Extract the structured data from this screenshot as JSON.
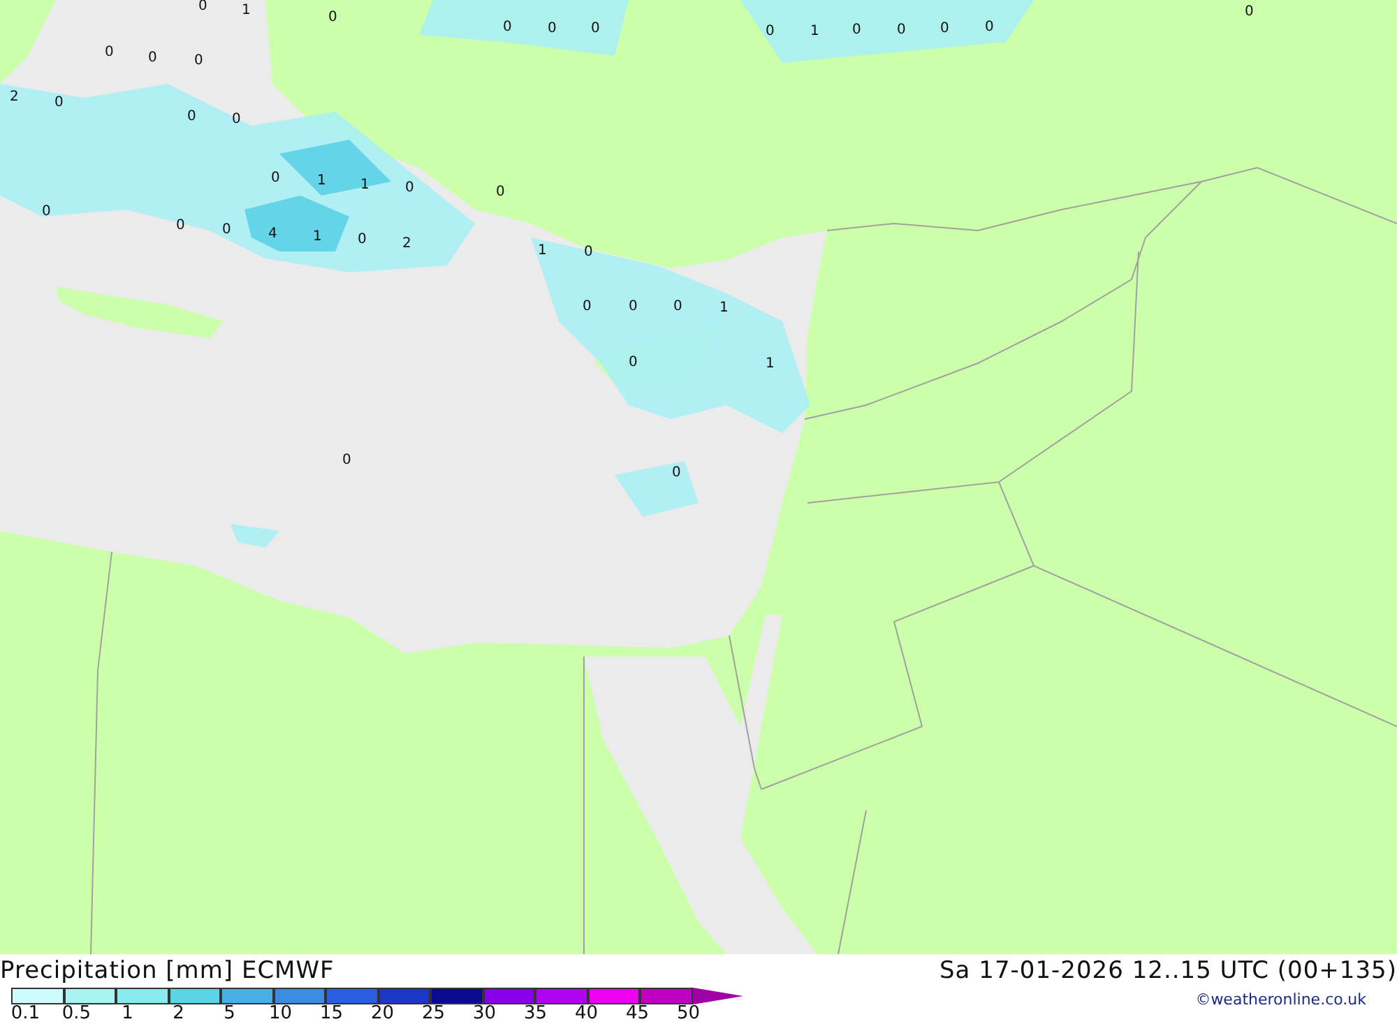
{
  "map_labels": [
    "0",
    "1",
    "0",
    "0",
    "0",
    "0",
    "0",
    "1",
    "0",
    "0",
    "0",
    "0",
    "0",
    "0",
    "0",
    "0",
    "2",
    "0",
    "0",
    "0",
    "0",
    "1",
    "1",
    "0",
    "0",
    "0",
    "0",
    "0",
    "4",
    "1",
    "0",
    "2",
    "1",
    "0",
    "0",
    "0",
    "0",
    "1",
    "0",
    "1",
    "0",
    "0"
  ],
  "title": "Precipitation [mm] ECMWF",
  "valid_time": "Sa 17-01-2026 12..15 UTC (00+135)",
  "legend": [
    {
      "label": "0.1",
      "color": "#ccfcfc"
    },
    {
      "label": "0.5",
      "color": "#a8f4f4"
    },
    {
      "label": "1",
      "color": "#88eaee"
    },
    {
      "label": "2",
      "color": "#5cd4e8"
    },
    {
      "label": "5",
      "color": "#46b0e4"
    },
    {
      "label": "10",
      "color": "#3a8ce0"
    },
    {
      "label": "15",
      "color": "#2a5ee0"
    },
    {
      "label": "20",
      "color": "#1c38c8"
    },
    {
      "label": "25",
      "color": "#0a0a90"
    },
    {
      "label": "30",
      "color": "#8800e8"
    },
    {
      "label": "35",
      "color": "#b000f0"
    },
    {
      "label": "40",
      "color": "#f000f0"
    },
    {
      "label": "45",
      "color": "#c000c0"
    },
    {
      "label": "50",
      "color": "#a000a8"
    }
  ],
  "copyright": "©weatheronline.co.uk"
}
